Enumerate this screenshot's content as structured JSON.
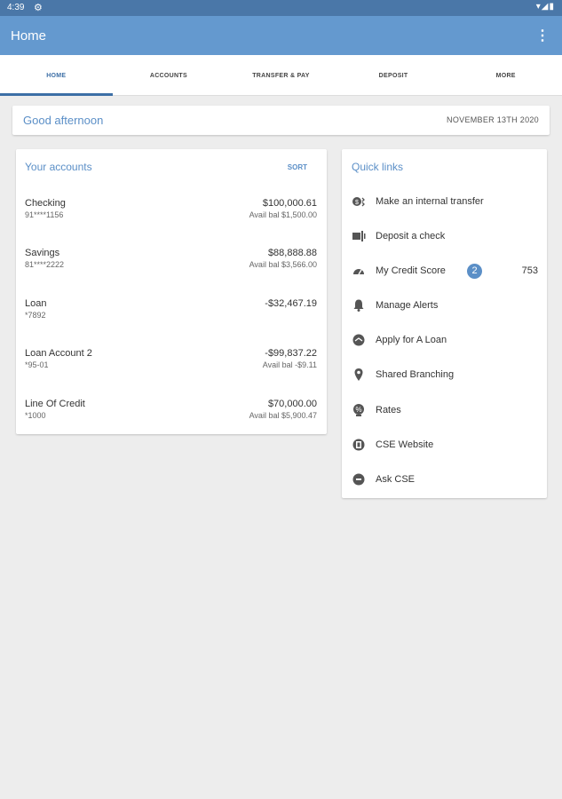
{
  "status": {
    "time": "4:39"
  },
  "app": {
    "title": "Home"
  },
  "tabs": [
    {
      "label": "HOME"
    },
    {
      "label": "ACCOUNTS"
    },
    {
      "label": "TRANSFER & PAY"
    },
    {
      "label": "DEPOSIT"
    },
    {
      "label": "MORE"
    }
  ],
  "greeting": {
    "text": "Good afternoon",
    "date": "NOVEMBER 13TH 2020"
  },
  "accounts": {
    "title": "Your accounts",
    "sort_label": "SORT",
    "items": [
      {
        "name": "Checking",
        "number": "91****1156",
        "balance": "$100,000.61",
        "avail": "Avail bal $1,500.00"
      },
      {
        "name": "Savings",
        "number": "81****2222",
        "balance": "$88,888.88",
        "avail": "Avail bal $3,566.00"
      },
      {
        "name": "Loan",
        "number": "*7892",
        "balance": "-$32,467.19",
        "avail": ""
      },
      {
        "name": "Loan Account 2",
        "number": "*95-01",
        "balance": "-$99,837.22",
        "avail": "Avail bal -$9.11"
      },
      {
        "name": "Line Of Credit",
        "number": "*1000",
        "balance": "$70,000.00",
        "avail": "Avail bal $5,900.47"
      }
    ]
  },
  "quick_links": {
    "title": "Quick links",
    "items": [
      {
        "label": "Make an internal transfer",
        "icon": "transfer-icon"
      },
      {
        "label": "Deposit a check",
        "icon": "check-deposit-icon"
      },
      {
        "label": "My Credit Score",
        "icon": "gauge-icon",
        "badge": "2",
        "score": "753"
      },
      {
        "label": "Manage Alerts",
        "icon": "bell-icon"
      },
      {
        "label": "Apply for A Loan",
        "icon": "loan-icon"
      },
      {
        "label": "Shared Branching",
        "icon": "location-pin-icon"
      },
      {
        "label": "Rates",
        "icon": "rates-icon"
      },
      {
        "label": "CSE Website",
        "icon": "website-icon"
      },
      {
        "label": "Ask CSE",
        "icon": "chat-icon"
      }
    ]
  },
  "colors": {
    "statusbar": "#4a77a8",
    "appbar": "#6499cf",
    "accent": "#5b8fc7",
    "background": "#ededed"
  }
}
